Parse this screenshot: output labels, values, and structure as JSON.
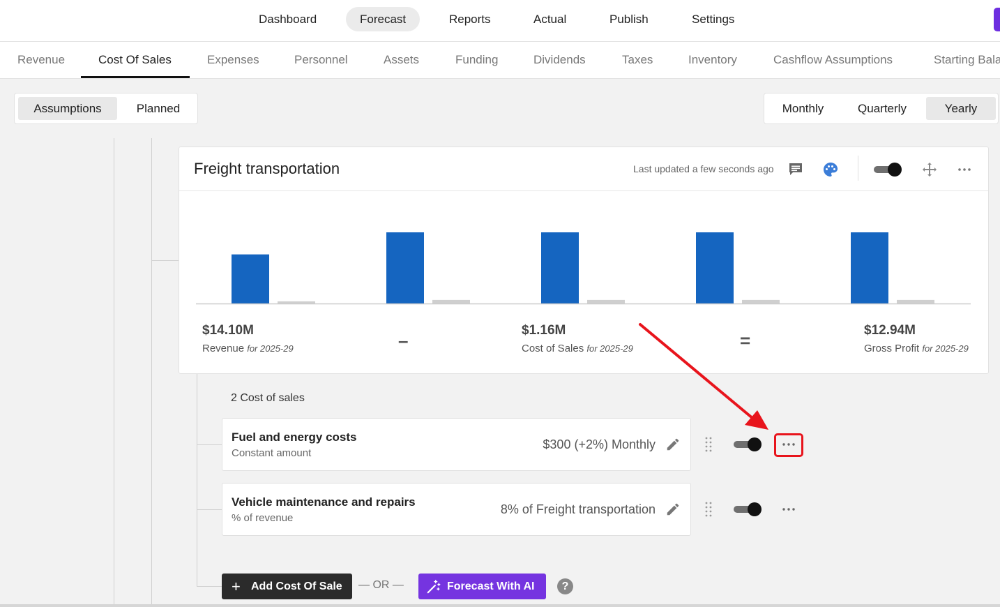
{
  "topnav": {
    "items": [
      {
        "label": "Dashboard"
      },
      {
        "label": "Forecast",
        "active": true
      },
      {
        "label": "Reports"
      },
      {
        "label": "Actual"
      },
      {
        "label": "Publish"
      },
      {
        "label": "Settings"
      }
    ]
  },
  "subnav": {
    "tabs": [
      {
        "label": "Revenue"
      },
      {
        "label": "Cost Of Sales",
        "active": true
      },
      {
        "label": "Expenses"
      },
      {
        "label": "Personnel"
      },
      {
        "label": "Assets"
      },
      {
        "label": "Funding"
      },
      {
        "label": "Dividends"
      },
      {
        "label": "Taxes"
      },
      {
        "label": "Inventory"
      },
      {
        "label": "Cashflow Assumptions"
      },
      {
        "label": "Starting Bala"
      }
    ]
  },
  "view_toggle": {
    "options": [
      "Assumptions",
      "Planned"
    ],
    "selected": "Assumptions"
  },
  "period_toggle": {
    "options": [
      "Monthly",
      "Quarterly",
      "Yearly"
    ],
    "selected": "Yearly"
  },
  "card": {
    "title": "Freight transportation",
    "updated": "Last updated a few seconds ago",
    "icons": [
      "comment-icon",
      "palette-icon",
      "toggle",
      "move-icon",
      "more-icon"
    ],
    "toggle_on": true
  },
  "chart_data": {
    "type": "bar",
    "categories": [
      "",
      "",
      "",
      "",
      ""
    ],
    "series": [
      {
        "values": [
          0.69,
          1.0,
          1.0,
          1.0,
          1.0
        ]
      },
      {
        "values": [
          0.03,
          0.05,
          0.05,
          0.05,
          0.05
        ]
      }
    ],
    "colors": [
      "#1565c0",
      "#cfcfcf"
    ],
    "grid": false,
    "legend": "none"
  },
  "summary": {
    "revenue": {
      "value": "$14.10M",
      "label": "Revenue",
      "period": "for 2025-29"
    },
    "minus": "–",
    "cost": {
      "value": "$1.16M",
      "label": "Cost of Sales",
      "period": "for 2025-29"
    },
    "equals": "=",
    "profit": {
      "value": "$12.94M",
      "label": "Gross Profit",
      "period": "for 2025-29"
    }
  },
  "items_count": "2 Cost of sales",
  "items": [
    {
      "name": "Fuel and energy costs",
      "type": "Constant amount",
      "value": "$300 (+2%) Monthly",
      "enabled": true,
      "highlighted": true
    },
    {
      "name": "Vehicle maintenance and repairs",
      "type": "% of revenue",
      "value": "8% of Freight transportation",
      "enabled": true
    }
  ],
  "actions": {
    "add_label": "Add Cost Of Sale",
    "or_label": "— OR —",
    "ai_label": "Forecast With AI",
    "help": "?"
  },
  "colors": {
    "accent": "#7534e0",
    "bar_primary": "#1565c0",
    "bar_secondary": "#cfcfcf",
    "highlight": "#e8141c"
  }
}
